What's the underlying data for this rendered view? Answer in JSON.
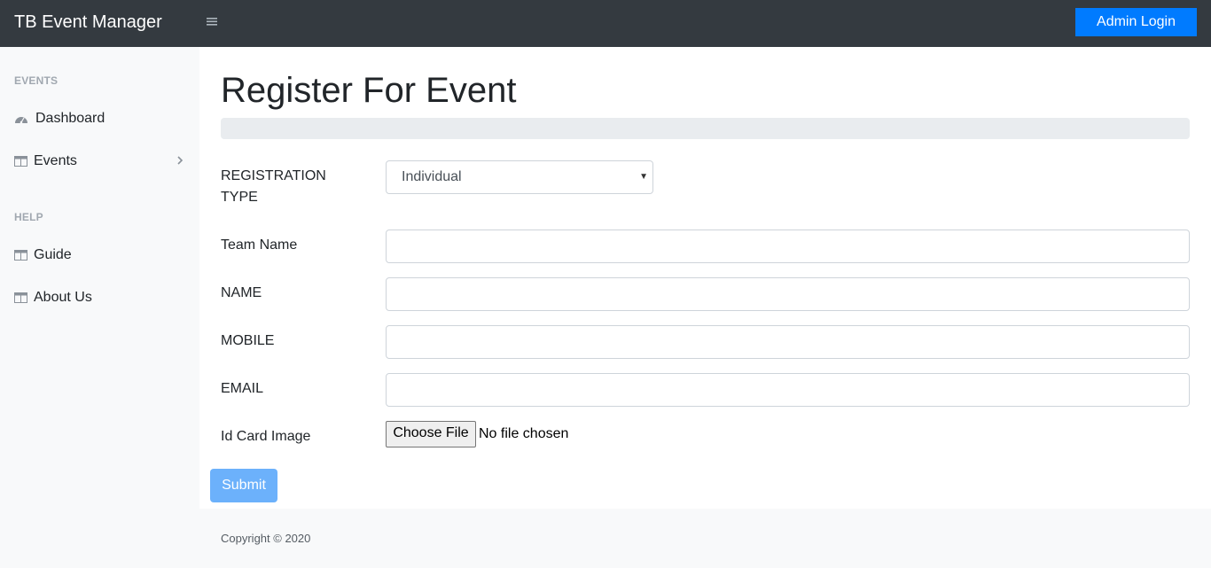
{
  "header": {
    "brand": "TB Event Manager",
    "menu_icon": "hamburger-menu-icon",
    "admin_login_label": "Admin Login"
  },
  "sidebar": {
    "sections": [
      {
        "heading": "EVENTS",
        "items": [
          {
            "label": "Dashboard",
            "icon": "dashboard-gauge-icon"
          },
          {
            "label": "Events",
            "icon": "table-icon",
            "expandable": true
          }
        ]
      },
      {
        "heading": "HELP",
        "items": [
          {
            "label": "Guide",
            "icon": "table-icon"
          },
          {
            "label": "About Us",
            "icon": "table-icon"
          }
        ]
      }
    ]
  },
  "main": {
    "title": "Register For Event",
    "form": {
      "registration_type": {
        "label_line1": "REGISTRATION",
        "label_line2": "TYPE",
        "selected": "Individual"
      },
      "team_name": {
        "label": "Team Name",
        "value": ""
      },
      "name": {
        "label": "NAME",
        "value": ""
      },
      "mobile": {
        "label": "MOBILE",
        "value": ""
      },
      "email": {
        "label": "EMAIL",
        "value": ""
      },
      "id_card": {
        "label": "Id Card Image",
        "button": "Choose File",
        "status": "No file chosen"
      },
      "submit_label": "Submit"
    }
  },
  "footer": {
    "copyright": "Copyright © 2020"
  },
  "colors": {
    "topbar": "#343a40",
    "primary": "#007bff",
    "submit_disabled": "#6cb1fb"
  }
}
